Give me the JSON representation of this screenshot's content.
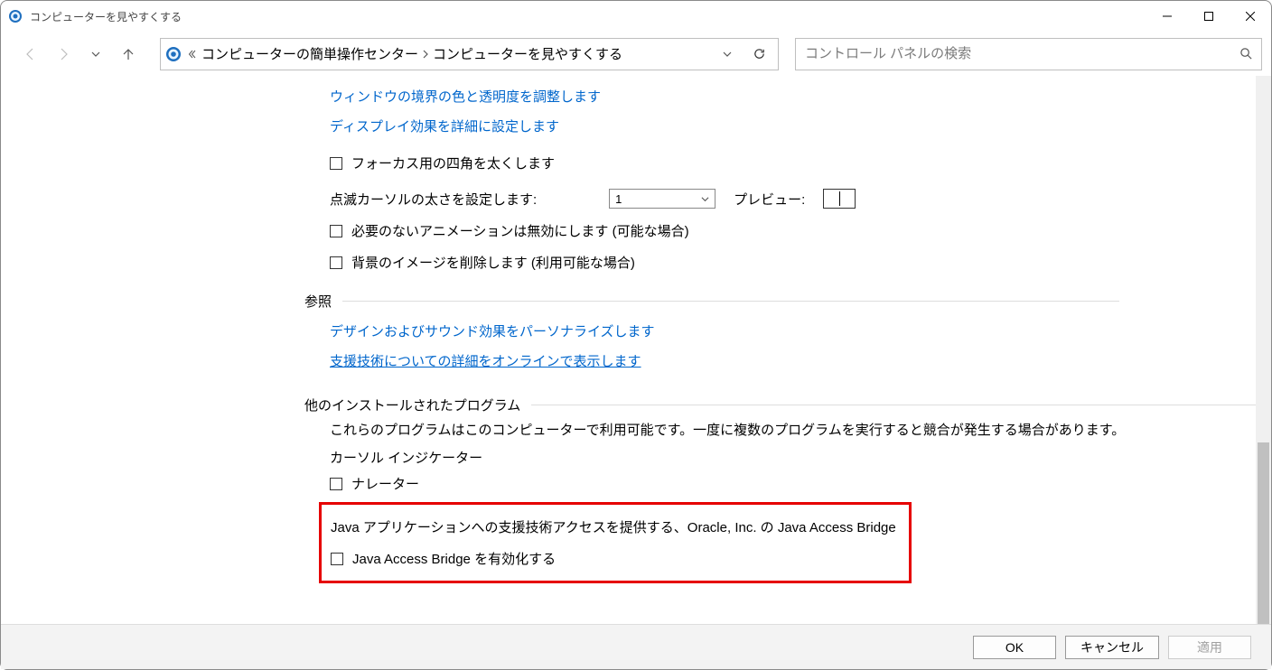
{
  "window": {
    "title": "コンピューターを見やすくする"
  },
  "breadcrumb": {
    "level1": "コンピューターの簡単操作センター",
    "level2": "コンピューターを見やすくする"
  },
  "search": {
    "placeholder": "コントロール パネルの検索"
  },
  "links": {
    "adjust_border": "ウィンドウの境界の色と透明度を調整します",
    "display_effects": "ディスプレイ効果を詳細に設定します",
    "personalize": "デザインおよびサウンド効果をパーソナライズします",
    "assistive_online": "支援技術についての詳細をオンラインで表示します"
  },
  "checkboxes": {
    "focus_rect": "フォーカス用の四角を太くします",
    "disable_anim": "必要のないアニメーションは無効にします (可能な場合)",
    "remove_bg": "背景のイメージを削除します (利用可能な場合)",
    "narrator": "ナレーター",
    "java_bridge": "Java Access Bridge を有効化する"
  },
  "cursor": {
    "label": "点滅カーソルの太さを設定します:",
    "value": "1",
    "preview_label": "プレビュー:"
  },
  "sections": {
    "reference": "参照",
    "other_programs": "他のインストールされたプログラム"
  },
  "descriptions": {
    "other_programs": "これらのプログラムはこのコンピューターで利用可能です。一度に複数のプログラムを実行すると競合が発生する場合があります。",
    "cursor_indicator": "カーソル インジケーター",
    "java_box": "Java アプリケーションへの支援技術アクセスを提供する、Oracle, Inc. の Java Access Bridge"
  },
  "buttons": {
    "ok": "OK",
    "cancel": "キャンセル",
    "apply": "適用"
  }
}
